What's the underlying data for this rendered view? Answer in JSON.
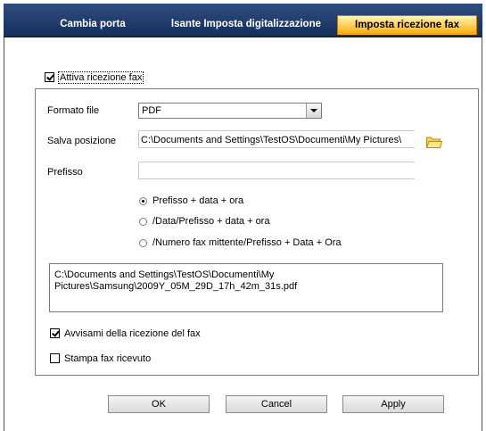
{
  "tabs": [
    {
      "label": "Cambia porta",
      "active": false
    },
    {
      "label": "Pulsante Imposta digitalizzazione",
      "active": false
    },
    {
      "label": "Imposta ricezione fax",
      "active": true
    }
  ],
  "enable_receive": {
    "label": "Attiva ricezione fax",
    "checked": true
  },
  "file_format": {
    "label": "Formato file",
    "value": "PDF"
  },
  "save_location": {
    "label": "Salva posizione",
    "value": "C:\\Documents and Settings\\TestOS\\Documenti\\My Pictures\\"
  },
  "prefix": {
    "label": "Prefisso",
    "value": ""
  },
  "name_options": [
    {
      "label": "Prefisso + data + ora",
      "checked": true
    },
    {
      "label": "/Data/Prefisso + data + ora",
      "checked": false
    },
    {
      "label": "/Numero fax mittente/Prefisso + Data + Ora",
      "checked": false
    }
  ],
  "preview_path": {
    "line1": "C:\\Documents and Settings\\TestOS\\Documenti\\My",
    "line2": "Pictures\\Samsung\\2009Y_05M_29D_17h_42m_31s.pdf"
  },
  "notify": {
    "label": "Avvisami della ricezione del fax",
    "checked": true
  },
  "print_received": {
    "label": "Stampa fax ricevuto",
    "checked": false
  },
  "buttons": {
    "ok": "OK",
    "cancel": "Cancel",
    "apply": "Apply"
  },
  "colors": {
    "tab_bg": "#17305c",
    "active_tab": "#ffc64a"
  }
}
